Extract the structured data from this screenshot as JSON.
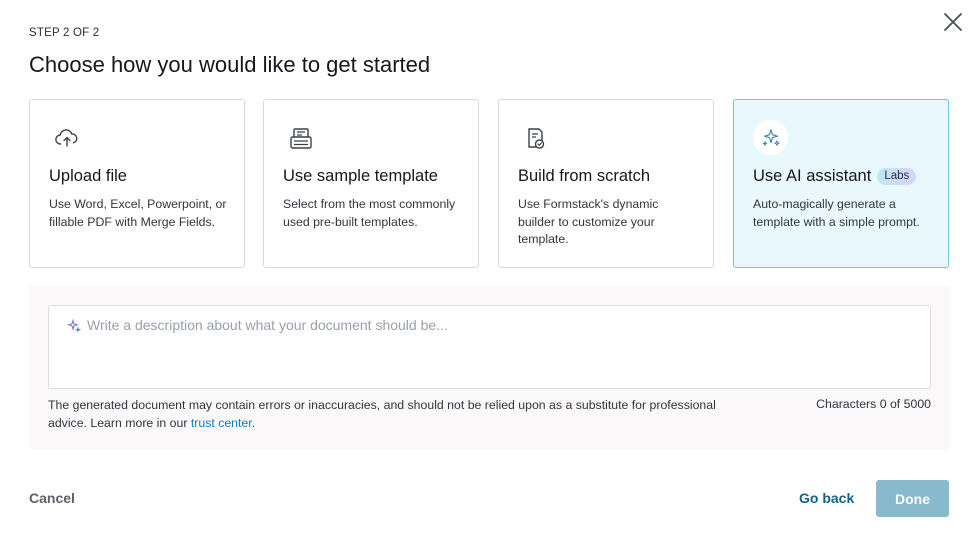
{
  "dialog": {
    "step_label": "STEP 2 OF 2",
    "title": "Choose how you would like to get started"
  },
  "cards": [
    {
      "icon": "cloud-upload-icon",
      "title": "Upload file",
      "description": "Use Word, Excel, Powerpoint, or fillable PDF with Merge Fields."
    },
    {
      "icon": "template-stack-icon",
      "title": "Use sample template",
      "description": "Select from the most commonly used pre-built templates."
    },
    {
      "icon": "document-build-icon",
      "title": "Build from scratch",
      "description": "Use Formstack's dynamic builder to customize your template."
    },
    {
      "icon": "sparkles-icon",
      "title": "Use AI assistant",
      "badge": "Labs",
      "description": "Auto-magically generate a template with a simple prompt.",
      "selected": true
    }
  ],
  "ai_panel": {
    "prompt_placeholder": "Write a description about what your document should be...",
    "prompt_value": "",
    "disclaimer_text": "The generated document may contain errors or inaccuracies, and should not be relied upon as a substitute for professional advice. Learn more in our ",
    "disclaimer_link": "trust center",
    "disclaimer_end": ".",
    "char_count": "Characters 0 of 5000"
  },
  "footer": {
    "cancel_label": "Cancel",
    "go_back_label": "Go back",
    "done_label": "Done"
  },
  "colors": {
    "accent": "#11628a",
    "link": "#0a7fb8",
    "selected_card_bg": "#e9f8fd",
    "selected_card_border": "#6cc7d9",
    "done_button_disabled": "#88b9cc"
  }
}
